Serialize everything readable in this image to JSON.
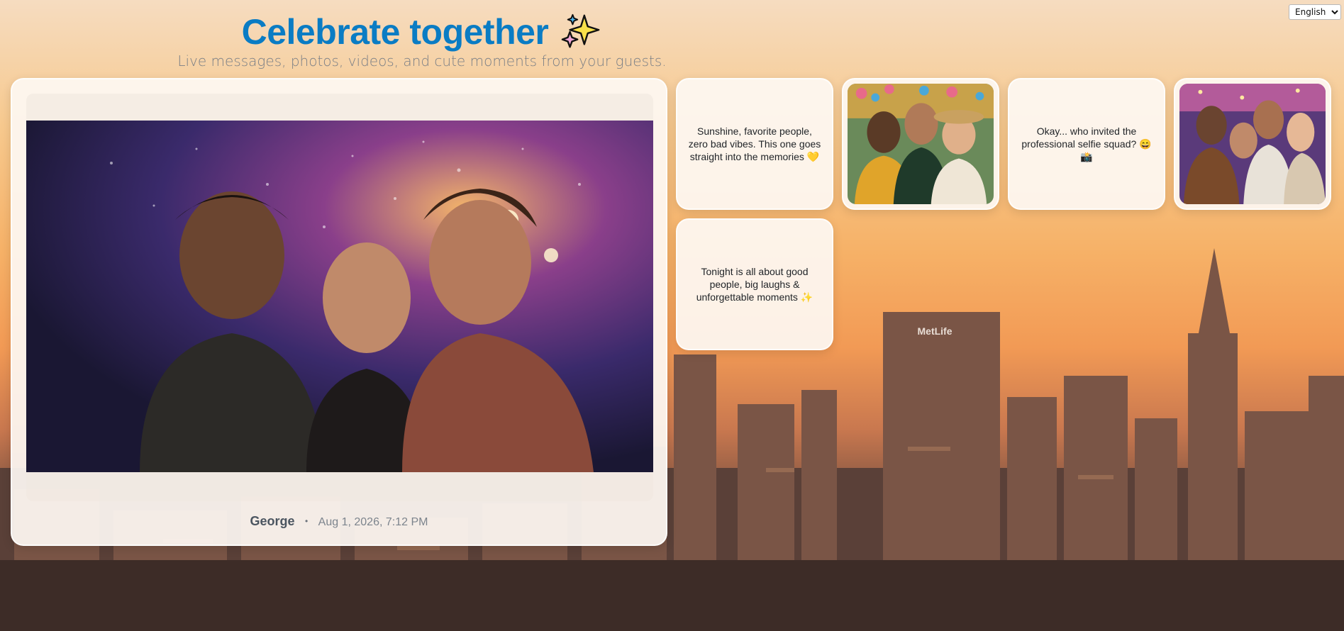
{
  "header": {
    "title": "Celebrate together",
    "subtitle": "Live messages, photos, videos, and cute moments from your guests."
  },
  "language": {
    "selected": "English",
    "options": [
      "English"
    ]
  },
  "featured": {
    "author": "George",
    "separator": "•",
    "timestamp": "Aug 1, 2026, 7:12 PM"
  },
  "tiles": [
    {
      "type": "text",
      "message": "Sunshine, favorite people, zero bad vibes. This one goes straight into the memories 💛"
    },
    {
      "type": "photo"
    },
    {
      "type": "text",
      "message": "Okay... who invited the professional selfie squad? 😄📸"
    },
    {
      "type": "photo"
    },
    {
      "type": "text",
      "message": "Tonight is all about good people, big laughs & unforgettable moments ✨"
    }
  ],
  "colors": {
    "title": "#0a7cc4",
    "subtitle": "#7a7f86",
    "card_background": "#fdf8f2"
  },
  "icons": {
    "title_icon": "sparkles-icon",
    "language_dropdown": "chevron-down-icon"
  }
}
